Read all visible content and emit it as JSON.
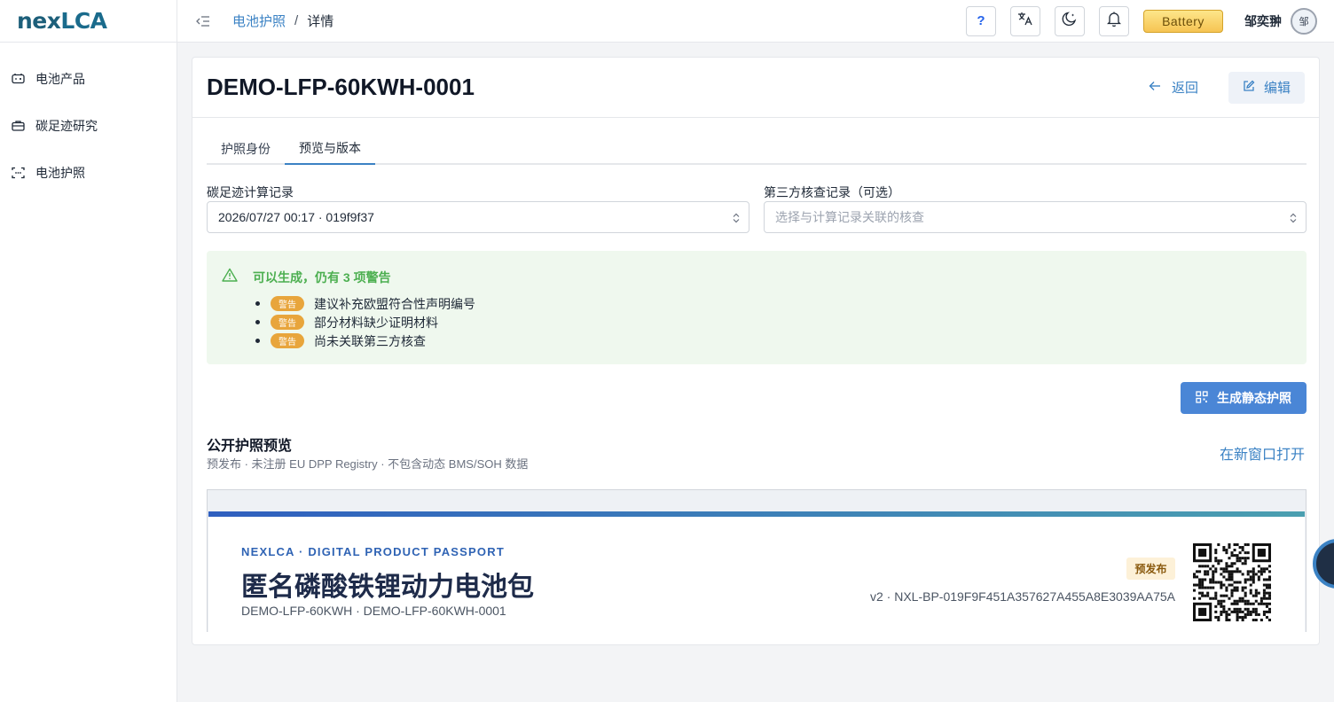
{
  "app": {
    "logo_prefix": "nex",
    "logo_suffix": "LCA"
  },
  "sidebar": {
    "items": [
      {
        "label": "电池产品",
        "icon": "battery-icon"
      },
      {
        "label": "碳足迹研究",
        "icon": "briefcase-icon"
      },
      {
        "label": "电池护照",
        "icon": "scan-icon"
      }
    ]
  },
  "header": {
    "breadcrumb_parent": "电池护照",
    "breadcrumb_sep": "/",
    "breadcrumb_current": "详情",
    "help_label": "?",
    "badge": "Battery",
    "username": "邹奕翀",
    "avatar_initial": "邹"
  },
  "page": {
    "title": "DEMO-LFP-60KWH-0001",
    "back_label": "返回",
    "edit_label": "编辑"
  },
  "tabs": [
    {
      "label": "护照身份",
      "active": false
    },
    {
      "label": "预览与版本",
      "active": true
    }
  ],
  "form": {
    "calc_label": "碳足迹计算记录",
    "calc_value": "2026/07/27 00:17 · 019f9f37",
    "verify_label": "第三方核查记录（可选）",
    "verify_placeholder": "选择与计算记录关联的核查"
  },
  "alert": {
    "title": "可以生成，仍有 3 项警告",
    "tag": "警告",
    "items": [
      "建议补充欧盟符合性声明编号",
      "部分材料缺少证明材料",
      "尚未关联第三方核查"
    ]
  },
  "generate_label": "生成静态护照",
  "preview": {
    "title": "公开护照预览",
    "subtitle": "预发布 · 未注册 EU DPP Registry · 不包含动态 BMS/SOH 数据",
    "open_link": "在新窗口打开"
  },
  "passport": {
    "eyebrow": "NEXLCA · DIGITAL PRODUCT PASSPORT",
    "title": "匿名磷酸铁锂动力电池包",
    "subtitle": "DEMO-LFP-60KWH · DEMO-LFP-60KWH-0001",
    "status": "预发布",
    "code": "v2 · NXL-BP-019F9F451A357627A455A8E3039AA75A"
  },
  "colors": {
    "accent": "#3b82c4",
    "primary_button": "#4a86d6",
    "alert_bg": "#eff8ee",
    "alert_text": "#4caf50",
    "warning_tag": "#e8a53c",
    "badge_gold": "#f6c453"
  }
}
